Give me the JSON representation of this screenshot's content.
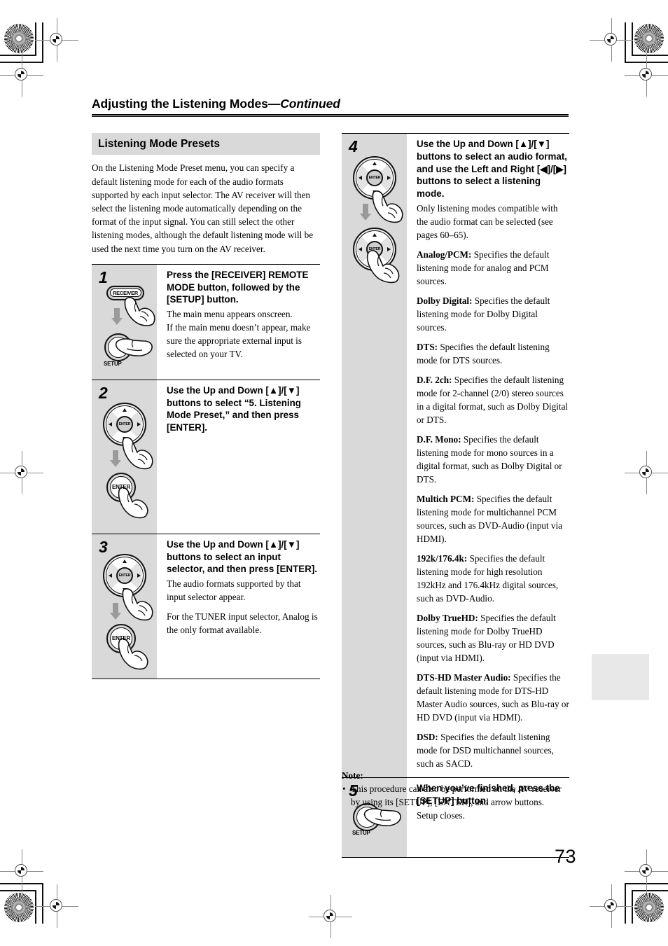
{
  "document": {
    "running_head_title": "Adjusting the Listening Modes",
    "running_head_continued": "—Continued",
    "page_number": "73"
  },
  "left_column": {
    "section_title": "Listening Mode Presets",
    "intro_paragraph": "On the Listening Mode Preset menu, you can specify a default listening mode for each of the audio formats supported by each input selector. The AV receiver will then select the listening mode automatically depending on the format of the input signal. You can still select the other listening modes, although the default listening mode will be used the next time you turn on the AV receiver.",
    "steps": [
      {
        "number": "1",
        "title": "Press the [RECEIVER] REMOTE MODE button, followed by the [SETUP] button.",
        "paragraphs": [
          "The main menu appears onscreen.",
          "If the main menu doesn’t appear, make sure the appropriate external input is selected on your TV."
        ],
        "figure": {
          "button_label": "RECEIVER",
          "second_button_caption": "SETUP"
        }
      },
      {
        "number": "2",
        "title": "Use the Up and Down [▲]/[▼] buttons to select “5. Listening Mode Preset,” and then press [ENTER].",
        "paragraphs": [],
        "figure": {
          "wheel_center_label": "ENTER",
          "enter_button_label": "ENTER"
        }
      },
      {
        "number": "3",
        "title": "Use the Up and Down [▲]/[▼] buttons to select an input selector, and then press [ENTER].",
        "paragraphs": [
          "The audio formats supported by that input selector appear.",
          "For the TUNER input selector, Analog is the only format available."
        ],
        "figure": {
          "wheel_center_label": "ENTER",
          "enter_button_label": "ENTER"
        }
      }
    ]
  },
  "right_column": {
    "steps": [
      {
        "number": "4",
        "title": "Use the Up and Down [▲]/[▼] buttons to select an audio format, and use the Left and Right [◀]/[▶] buttons to select a listening mode.",
        "intro": "Only listening modes compatible with the audio format can be selected (see pages 60–65).",
        "definitions": [
          {
            "term": "Analog/PCM:",
            "text": " Specifies the default listening mode for analog and PCM sources."
          },
          {
            "term": "Dolby Digital:",
            "text": " Specifies the default listening mode for Dolby Digital sources."
          },
          {
            "term": "DTS:",
            "text": " Specifies the default listening mode for DTS sources."
          },
          {
            "term": "D.F. 2ch:",
            "text": " Specifies the default listening mode for 2-channel (2/0) stereo sources in a digital format, such as Dolby Digital or DTS."
          },
          {
            "term": "D.F. Mono:",
            "text": " Specifies the default listening mode for mono sources in a digital format, such as Dolby Digital or DTS."
          },
          {
            "term": "Multich PCM:",
            "text": " Specifies the default listening mode for multichannel PCM sources, such as DVD-Audio (input via HDMI)."
          },
          {
            "term": "192k/176.4k:",
            "text": " Specifies the default listening mode for high resolution 192kHz and 176.4kHz digital sources, such as DVD-Audio."
          },
          {
            "term": "Dolby TrueHD:",
            "text": " Specifies the default listening mode for Dolby TrueHD sources, such as Blu-ray or HD DVD (input via HDMI)."
          },
          {
            "term": "DTS-HD Master Audio:",
            "text": " Specifies the default listening mode for DTS-HD Master Audio sources, such as Blu-ray or HD DVD (input via HDMI)."
          },
          {
            "term": "DSD:",
            "text": " Specifies the default listening mode for DSD multichannel sources, such as SACD."
          }
        ],
        "figure": {
          "wheel_center_label": "ENTER"
        }
      },
      {
        "number": "5",
        "title": "When you’ve finished, press the [SETUP] button.",
        "paragraphs": [
          "Setup closes."
        ],
        "figure": {
          "button_caption": "SETUP"
        }
      }
    ],
    "note": {
      "title": "Note:",
      "items": [
        "This procedure can also be performed on the AV receiver by using its [SETUP], [ENTER], and arrow buttons."
      ]
    }
  },
  "colors": {
    "figure_panel": "#d9d9d9",
    "section_band": "#d9d9d9",
    "thumb_tab": "#e8e8e8",
    "rule": "#000000"
  }
}
